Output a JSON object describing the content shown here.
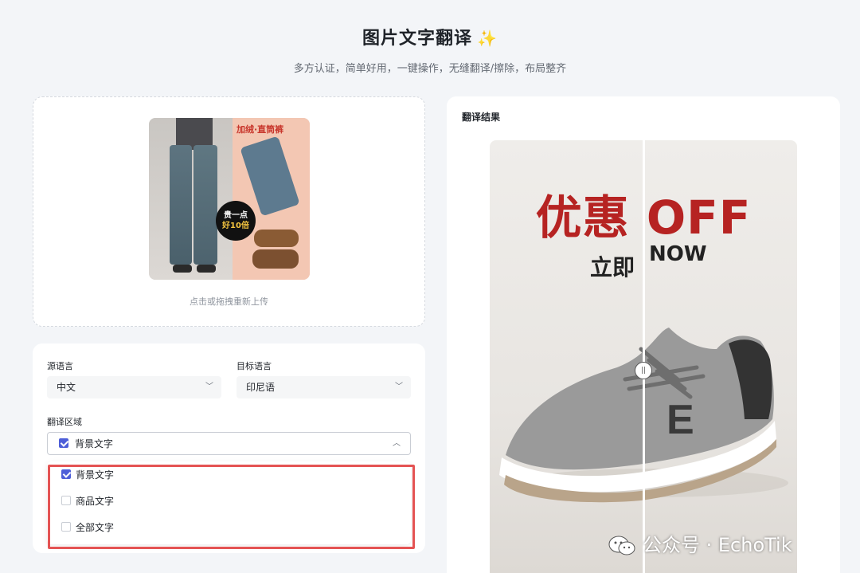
{
  "header": {
    "title": "图片文字翻译",
    "title_icon": "sparkle-icon",
    "subtitle": "多方认证，简单好用，一键操作，无缝翻译/擦除，布局整齐"
  },
  "upload": {
    "image_tag": "加绒·直筒裤",
    "badge_line1": "贵一点",
    "badge_line2": "好10倍",
    "hint": "点击或拖拽重新上传"
  },
  "settings": {
    "source_label": "源语言",
    "source_value": "中文",
    "target_label": "目标语言",
    "target_value": "印尼语",
    "area_label": "翻译区域",
    "area_value": "背景文字",
    "area_options": [
      {
        "label": "背景文字",
        "checked": true
      },
      {
        "label": "商品文字",
        "checked": false
      },
      {
        "label": "全部文字",
        "checked": false
      }
    ]
  },
  "result": {
    "title": "翻译结果",
    "headline": "优惠 OFF",
    "sub_left": "立即",
    "sub_right": "NOW",
    "shoe_letter": "E"
  },
  "watermark": {
    "text": "公众号 · EchoTik",
    "icon": "wechat-icon"
  },
  "colors": {
    "accent": "#4e5fd8",
    "highlight": "#e45353",
    "headline_red": "#b62322"
  }
}
